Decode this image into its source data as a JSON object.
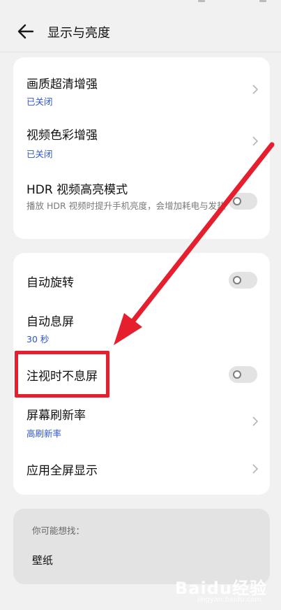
{
  "header": {
    "title": "显示与亮度"
  },
  "group1": [
    {
      "label": "画质超清增强",
      "sub": "已关闭"
    },
    {
      "label": "视频色彩增强",
      "sub": "已关闭"
    },
    {
      "label": "HDR 视频高亮模式",
      "desc": "播放 HDR 视频时提升手机亮度，会增加耗电与发热"
    }
  ],
  "group2": [
    {
      "label": "自动旋转"
    },
    {
      "label": "自动息屏",
      "sub": "30 秒"
    },
    {
      "label": "注视时不息屏"
    },
    {
      "label": "屏幕刷新率",
      "sub": "高刷新率"
    },
    {
      "label": "应用全屏显示"
    }
  ],
  "suggest": {
    "hint": "你可能想找：",
    "item": "壁纸"
  },
  "watermark": {
    "brand": "Baidu经验",
    "url": "jingyan.baidu.com"
  },
  "colors": {
    "accent": "#2c56c9",
    "annotation": "#e61f2e",
    "background": "#f1f1f1"
  }
}
